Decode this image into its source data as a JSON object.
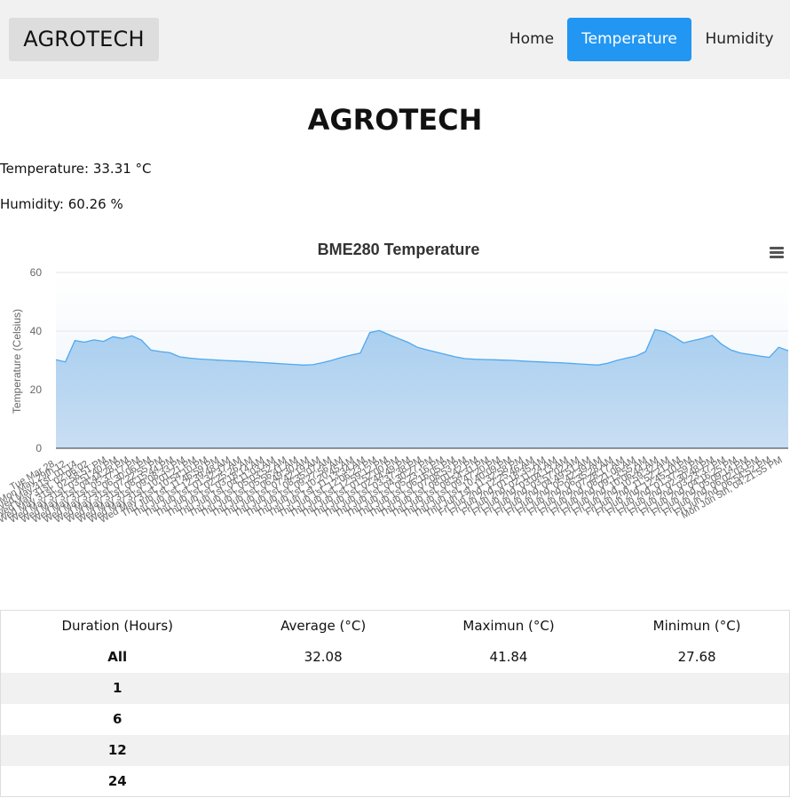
{
  "nav": {
    "brand": "AGROTECH",
    "links": [
      {
        "label": "Home",
        "active": false
      },
      {
        "label": "Temperature",
        "active": true
      },
      {
        "label": "Humidity",
        "active": false
      }
    ],
    "active_color": "#2196f3"
  },
  "page": {
    "title": "AGROTECH",
    "temperature_text": "Temperature: 33.31 °C",
    "humidity_text": "Humidity: 60.26 %"
  },
  "chart_data": {
    "type": "area",
    "title": "BME280 Temperature",
    "ylabel": "Temperature (Celsius)",
    "xlabel": "",
    "ylim": [
      0,
      60
    ],
    "yticks": [
      0,
      20,
      40,
      60
    ],
    "grid": true,
    "color": "#7cb5ec",
    "menu_icon": "hamburger-menu-icon",
    "categories": [
      "Tue Mar 28...",
      "Mon May 29th 12...",
      "Wed May 31st, 01:14...",
      "Wed May 31st, 02:06:02...",
      "Wed May 31st, 02:58:51 PM",
      "Wed May 31st, 03:51:40 PM",
      "Wed May 31st, 04:44:28 PM",
      "Wed May 31st, 05:37:17 PM",
      "Wed May 31st, 06:30:06 PM",
      "Wed May 31st, 07:22:55 PM",
      "Wed May 31st, 08:15:44 PM",
      "Wed May 31st, 09:08:33 PM",
      "Wed May 31st, 10:01:21 PM",
      "Wed May 31st, 10:54:10 PM",
      "Thu Jun 1st, 11:46:59 PM",
      "Thu Jun 1st, 12:39:48 AM",
      "Thu Jun 1st, 01:32:37 AM",
      "Thu Jun 1st, 02:25:26 AM",
      "Thu Jun 1st, 03:18:14 AM",
      "Thu Jun 1st, 04:11:03 AM",
      "Thu Jun 1st, 05:03:52 AM",
      "Thu Jun 1st, 05:56:41 AM",
      "Thu Jun 1st, 06:49:30 AM",
      "Thu Jun 1st, 07:42:19 AM",
      "Thu Jun 1st, 08:35:07 AM",
      "Thu Jun 1st, 09:27:56 AM",
      "Thu Jun 1st, 10:20:45 AM",
      "Thu Jun 1st, 11:13:34 AM",
      "Thu Jun 1st, 12:06:23 PM",
      "Thu Jun 1st, 12:59:12 PM",
      "Thu Jun 1st, 01:52:00 PM",
      "Thu Jun 1st, 02:44:49 PM",
      "Thu Jun 1st, 03:37:38 PM",
      "Thu Jun 1st, 04:30:27 PM",
      "Thu Jun 1st, 05:23:16 PM",
      "Thu Jun 1st, 06:16:05 PM",
      "Thu Jun 1st, 07:08:53 PM",
      "Thu Jun 1st, 08:01:42 PM",
      "Thu Jun 1st, 08:54:31 PM",
      "Thu Jun 1st, 09:47:20 PM",
      "Thu Jun 1st, 10:40:09 PM",
      "Thu Jun 1st, 11:32:58 PM",
      "Fri Jun 2nd, 12:25:46 AM",
      "Fri Jun 2nd, 01:18:35 AM",
      "Fri Jun 2nd, 02:11:24 AM",
      "Fri Jun 2nd, 03:04:13 AM",
      "Fri Jun 2nd, 03:57:02 AM",
      "Fri Jun 2nd, 04:49:51 AM",
      "Fri Jun 2nd, 05:42:39 AM",
      "Fri Jun 2nd, 06:35:28 AM",
      "Fri Jun 2nd, 07:28:17 AM",
      "Fri Jun 2nd, 08:21:06 AM",
      "Fri Jun 2nd, 09:13:55 AM",
      "Fri Jun 2nd, 10:06:44 AM",
      "Fri Jun 2nd, 10:59:32 AM",
      "Fri Jun 2nd, 11:52:21 AM",
      "Fri Jun 2nd, 12:45:10 PM",
      "Fri Jun 2nd, 01:37:59 PM",
      "Fri Jun 2nd, 02:30:48 PM",
      "Fri Jun 2nd, 03:23:37 PM",
      "Fri Jun 2nd, 04:16:25 PM",
      "Fri Jun 2nd, 05:09:14 PM",
      "Fri Jun 2nd, 06:02:03 PM",
      "Fri Jun 2nd, 06:54:52 PM",
      "Mon Jun 5th, 04:21:55 PM"
    ],
    "values": [
      30.2,
      29.5,
      36.8,
      36.2,
      37.0,
      36.5,
      38.1,
      37.5,
      38.4,
      36.9,
      33.5,
      33.0,
      32.6,
      31.2,
      30.8,
      30.5,
      30.3,
      30.1,
      29.9,
      29.8,
      29.6,
      29.4,
      29.2,
      29.0,
      28.8,
      28.6,
      28.4,
      28.5,
      29.2,
      30.0,
      31.0,
      31.8,
      32.5,
      39.5,
      40.2,
      38.8,
      37.5,
      36.2,
      34.5,
      33.6,
      32.8,
      32.0,
      31.2,
      30.6,
      30.4,
      30.3,
      30.2,
      30.1,
      30.0,
      29.8,
      29.6,
      29.5,
      29.3,
      29.2,
      29.0,
      28.8,
      28.6,
      28.4,
      29.0,
      30.0,
      30.8,
      31.5,
      33.0,
      40.5,
      39.8,
      38.0,
      36.0,
      36.8,
      37.5,
      38.5,
      35.5,
      33.5,
      32.5,
      32.0,
      31.5,
      31.0,
      34.5,
      33.3
    ]
  },
  "table": {
    "headers": [
      "Duration (Hours)",
      "Average (°C)",
      "Maximun (°C)",
      "Minimun (°C)"
    ],
    "rows": [
      {
        "duration": "All",
        "average": "32.08",
        "maximum": "41.84",
        "minimum": "27.68"
      },
      {
        "duration": "1",
        "average": "",
        "maximum": "",
        "minimum": ""
      },
      {
        "duration": "6",
        "average": "",
        "maximum": "",
        "minimum": ""
      },
      {
        "duration": "12",
        "average": "",
        "maximum": "",
        "minimum": ""
      },
      {
        "duration": "24",
        "average": "",
        "maximum": "",
        "minimum": ""
      }
    ]
  }
}
